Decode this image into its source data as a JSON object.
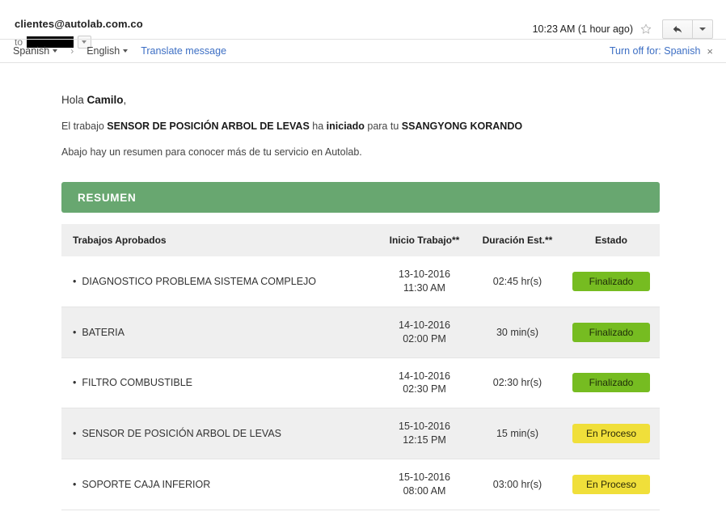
{
  "mail_header": {
    "sender_email": "clientes@autolab.com.co",
    "to_label": "to",
    "recipient_redacted": "",
    "timestamp": "10:23 AM (1 hour ago)",
    "star_icon": "star-outline-icon",
    "reply_icon": "reply-arrow-icon",
    "more_icon": "chevron-down-icon",
    "recipient_expand_icon": "chevron-down-icon"
  },
  "translate_bar": {
    "source_language": "Spanish",
    "arrow": "›",
    "target_language": "English",
    "translate_link": "Translate message",
    "turn_off_link": "Turn off for: Spanish",
    "close_icon": "×"
  },
  "email": {
    "greeting_prefix": "Hola ",
    "greeting_name": "Camilo",
    "greeting_suffix": ",",
    "job_line_1": "El trabajo ",
    "job_line_name": "SENSOR DE POSICIÓN ARBOL DE LEVAS",
    "job_line_2": " ha ",
    "job_line_status": "iniciado",
    "job_line_3": " para tu ",
    "job_line_vehicle": "SSANGYONG KORANDO",
    "sub_line": "Abajo hay un resumen para conocer más de tu servicio en Autolab."
  },
  "summary": {
    "bar_title": "RESUMEN",
    "bar_color": "#68a770",
    "columns": [
      "Trabajos Aprobados",
      "Inicio Trabajo**",
      "Duración Est.**",
      "Estado"
    ],
    "rows": [
      {
        "job": "DIAGNOSTICO PROBLEMA SISTEMA COMPLEJO",
        "start_date": "13-10-2016",
        "start_time": "11:30 AM",
        "duration": "02:45 hr(s)",
        "status": "Finalizado",
        "status_kind": "finalizado",
        "status_color": "#76bc21"
      },
      {
        "job": "BATERIA",
        "start_date": "14-10-2016",
        "start_time": "02:00 PM",
        "duration": "30 min(s)",
        "status": "Finalizado",
        "status_kind": "finalizado",
        "status_color": "#76bc21"
      },
      {
        "job": "FILTRO COMBUSTIBLE",
        "start_date": "14-10-2016",
        "start_time": "02:30 PM",
        "duration": "02:30 hr(s)",
        "status": "Finalizado",
        "status_kind": "finalizado",
        "status_color": "#76bc21"
      },
      {
        "job": "SENSOR DE POSICIÓN ARBOL DE LEVAS",
        "start_date": "15-10-2016",
        "start_time": "12:15 PM",
        "duration": "15 min(s)",
        "status": "En Proceso",
        "status_kind": "proceso",
        "status_color": "#f0df3a"
      },
      {
        "job": "SOPORTE CAJA INFERIOR",
        "start_date": "15-10-2016",
        "start_time": "08:00 AM",
        "duration": "03:00 hr(s)",
        "status": "En Proceso",
        "status_kind": "proceso",
        "status_color": "#f0df3a"
      }
    ]
  }
}
